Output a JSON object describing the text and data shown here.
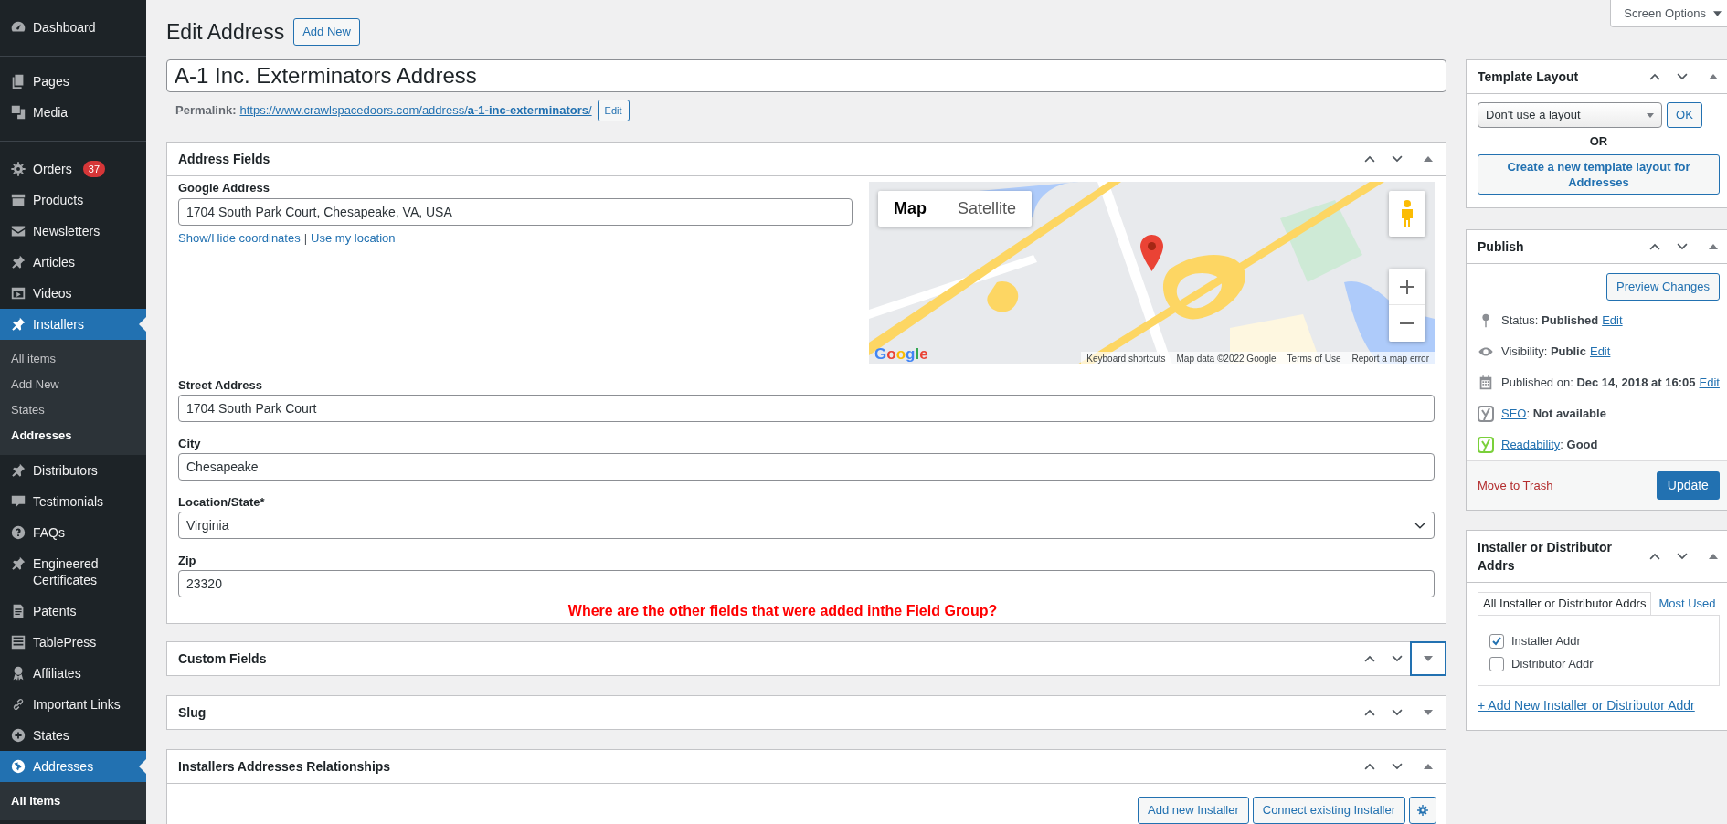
{
  "sidebar": {
    "sections": [
      {
        "items": [
          {
            "label": "Dashboard",
            "selected": false
          }
        ]
      },
      {
        "items": [
          {
            "label": "Pages",
            "selected": false
          },
          {
            "label": "Media",
            "selected": false
          }
        ]
      },
      {
        "items": [
          {
            "label": "Orders",
            "selected": false,
            "badge": "37"
          },
          {
            "label": "Products",
            "selected": false
          },
          {
            "label": "Newsletters",
            "selected": false
          },
          {
            "label": "Articles",
            "selected": false
          },
          {
            "label": "Videos",
            "selected": false
          },
          {
            "label": "Installers",
            "selected": true,
            "children": [
              {
                "label": "All items",
                "selected": false
              },
              {
                "label": "Add New",
                "selected": false
              },
              {
                "label": "States",
                "selected": false
              },
              {
                "label": "Addresses",
                "selected": true
              }
            ]
          },
          {
            "label": "Distributors",
            "selected": false
          },
          {
            "label": "Testimonials",
            "selected": false
          },
          {
            "label": "FAQs",
            "selected": false
          },
          {
            "label": "Engineered Certificates",
            "selected": false
          },
          {
            "label": "Patents",
            "selected": false
          },
          {
            "label": "TablePress",
            "selected": false
          },
          {
            "label": "Affiliates",
            "selected": false
          },
          {
            "label": "Important Links",
            "selected": false
          },
          {
            "label": "States",
            "selected": false
          },
          {
            "label": "Addresses",
            "selected": true,
            "children": [
              {
                "label": "All items",
                "selected": true
              }
            ]
          }
        ]
      }
    ]
  },
  "page": {
    "title": "Edit Address",
    "add_new": "Add New",
    "post_title": "A-1 Inc. Exterminators Address",
    "permalink_label": "Permalink:",
    "permalink": "https://www.crawlspacedoors.com/address/**a-1-inc-exterminators**/",
    "permalink_edit": "Edit"
  },
  "main_panels": [
    {
      "kind": "address",
      "title": "Address Fields",
      "expanded": true,
      "focused": false,
      "google_address": {
        "label": "Google Address",
        "value": "1704 South Park Court, Chesapeake, VA, USA",
        "links": [
          "Show/Hide coordinates",
          "Use my location"
        ],
        "separator": "|"
      },
      "map": {
        "types": [
          {
            "label": "Map",
            "selected": true
          },
          {
            "label": "Satellite",
            "selected": false
          }
        ],
        "logo": "Google",
        "footer": [
          "Keyboard shortcuts",
          "Map data ©2022 Google",
          "Terms of Use",
          "Report a map error"
        ]
      },
      "fields": [
        {
          "kind": "text",
          "label": "Street Address",
          "value": "1704 South Park Court"
        },
        {
          "kind": "text",
          "label": "City",
          "value": "Chesapeake"
        },
        {
          "kind": "select",
          "label": "Location/State*",
          "value": "Virginia"
        },
        {
          "kind": "text",
          "label": "Zip",
          "value": "23320"
        }
      ],
      "note": "Where are the other fields that were added inthe Field Group?"
    },
    {
      "title": "Custom Fields",
      "expanded": false,
      "focused": true
    },
    {
      "title": "Slug",
      "expanded": false,
      "focused": false
    },
    {
      "kind": "relationships",
      "title": "Installers Addresses Relationships",
      "expanded": true,
      "focused": false,
      "buttons": [
        "Add new Installer",
        "Connect existing Installer"
      ]
    }
  ],
  "screen_options": "Screen Options",
  "side_panels": [
    {
      "kind": "template",
      "title": "Template Layout",
      "expanded": true,
      "focused": false,
      "select_value": "Don't use a layout",
      "ok": "OK",
      "or": "OR",
      "create": "Create a new template layout for Addresses"
    },
    {
      "kind": "publish",
      "title": "Publish",
      "expanded": true,
      "focused": false,
      "preview": "Preview Changes",
      "rows": [
        {
          "kind": "meta",
          "text": "Status: **Published**",
          "link": "Edit"
        },
        {
          "kind": "meta",
          "text": "Visibility: **Public**",
          "link": "Edit"
        },
        {
          "kind": "meta",
          "text": "Published on: **Dec 14, 2018 at 16:05**",
          "link": "Edit"
        },
        {
          "kind": "score",
          "color": "#8c8f94",
          "link": "SEO",
          "text": ": **Not available**"
        },
        {
          "kind": "score",
          "color": "#7ad03a",
          "link": "Readability",
          "text": ": **Good**"
        }
      ],
      "trash": "Move to Trash",
      "update": "Update"
    },
    {
      "kind": "taxonomy",
      "title": "Installer or Distributor Addrs",
      "expanded": true,
      "focused": false,
      "tabs": [
        {
          "label": "All Installer or Distributor Addrs",
          "selected": true
        },
        {
          "label": "Most Used",
          "selected": false
        }
      ],
      "items": [
        {
          "label": "Installer Addr",
          "checked": true
        },
        {
          "label": "Distributor Addr",
          "checked": false
        }
      ],
      "add_link": "+ Add New Installer or Distributor Addr"
    }
  ]
}
